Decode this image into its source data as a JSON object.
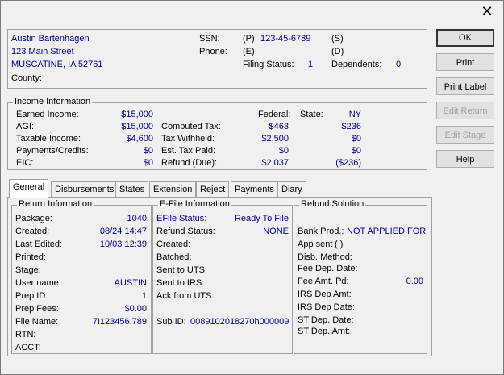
{
  "window": {
    "close_glyph": "✕"
  },
  "taxpayer": {
    "name": "Austin Bartenhagen",
    "street": "123 Main Street",
    "city_state_zip": "MUSCATINE, IA  52761",
    "county_label": "County:",
    "ssn_label": "SSN:",
    "ssn_p": "(P)",
    "ssn_value": "123-45-6789",
    "ssn_s": "(S)",
    "phone_label": "Phone:",
    "phone_e": "(E)",
    "phone_d": "(D)",
    "filing_status_label": "Filing Status:",
    "filing_status_value": "1",
    "dependents_label": "Dependents:",
    "dependents_value": "0"
  },
  "income": {
    "legend": "Income Information",
    "earned_label": "Earned Income:",
    "earned_value": "$15,000",
    "agi_label": "AGI:",
    "agi_value": "$15,000",
    "taxable_label": "Taxable Income:",
    "taxable_value": "$4,600",
    "payments_label": "Payments/Credits:",
    "payments_value": "$0",
    "eic_label": "EIC:",
    "eic_value": "$0",
    "federal_label": "Federal:",
    "state_label": "State:",
    "state_value": "NY",
    "computed_label": "Computed Tax:",
    "computed_fed": "$463",
    "computed_state": "$236",
    "withheld_label": "Tax Withheld:",
    "withheld_fed": "$2,500",
    "withheld_state": "$0",
    "est_label": "Est. Tax Paid:",
    "est_fed": "$0",
    "est_state": "$0",
    "refund_label": "Refund (Due):",
    "refund_fed": "$2,037",
    "refund_state": "($236)"
  },
  "buttons": {
    "ok": "OK",
    "print": "Print",
    "print_label": "Print Label",
    "edit_return": "Edit Return",
    "edit_stage": "Edit Stage",
    "help": "Help"
  },
  "tabs": [
    "General",
    "Disbursements",
    "States",
    "Extension",
    "Reject",
    "Payments",
    "Diary"
  ],
  "return_info": {
    "legend": "Return Information",
    "package_label": "Package:",
    "package_value": "1040",
    "created_label": "Created:",
    "created_value": "08/24 14:47",
    "edited_label": "Last Edited:",
    "edited_value": "10/03 12:39",
    "printed_label": "Printed:",
    "stage_label": "Stage:",
    "user_label": "User name:",
    "user_value": "AUSTIN",
    "prep_id_label": "Prep ID:",
    "prep_id_value": "1",
    "prep_fees_label": "Prep Fees:",
    "prep_fees_value": "$0.00",
    "file_name_label": "File Name:",
    "file_name_value": "7I123456.789",
    "rtn_label": "RTN:",
    "acct_label": "ACCT:"
  },
  "efile": {
    "legend": "E-File Information",
    "status_label": "EFile Status:",
    "status_value": "Ready To File",
    "refund_status_label": "Refund Status:",
    "refund_status_value": "NONE",
    "created_label": "Created:",
    "batched_label": "Batched:",
    "sent_uts_label": "Sent to UTS:",
    "sent_irs_label": "Sent to IRS:",
    "ack_label": "Ack from UTS:",
    "sub_id_label": "Sub ID:",
    "sub_id_value": "0089102018270h000009"
  },
  "refund_solution": {
    "legend": "Refund Solution",
    "bank_label": "Bank Prod.:",
    "bank_value": "NOT APPLIED FOR",
    "app_sent_label": "App sent",
    "app_sent_value": "(  )",
    "disb_label": "Disb. Method:",
    "fee_dep_label": "Fee Dep. Date:",
    "fee_amt_label": "Fee Amt. Pd:",
    "fee_amt_value": "0.00",
    "irs_amt_label": "IRS Dep Amt:",
    "irs_date_label": "IRS Dep Date:",
    "st_date_label": "ST Dep. Date:",
    "st_amt_label": "ST Dep. Amt:"
  }
}
